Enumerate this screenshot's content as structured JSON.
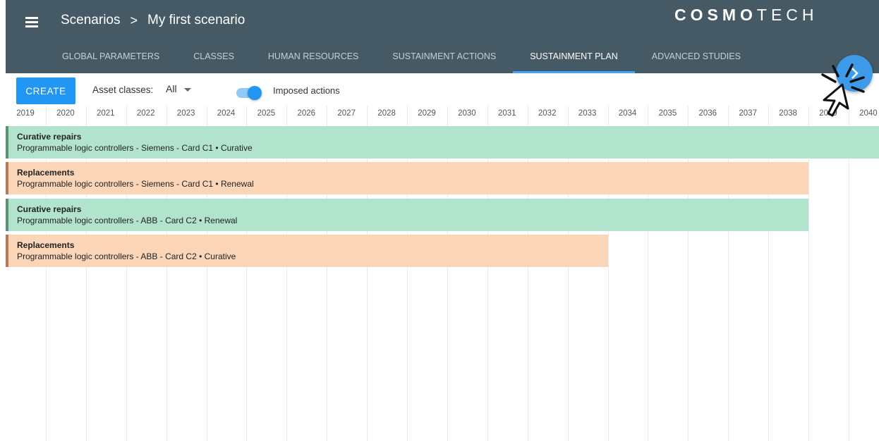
{
  "header": {
    "breadcrumb_root": "Scenarios",
    "breadcrumb_separator": ">",
    "breadcrumb_current": "My first scenario",
    "logo_bold": "COSMO",
    "logo_light": "TECH"
  },
  "tabs": [
    {
      "label": "GLOBAL PARAMETERS"
    },
    {
      "label": "CLASSES"
    },
    {
      "label": "HUMAN RESOURCES"
    },
    {
      "label": "SUSTAINMENT ACTIONS"
    },
    {
      "label": "SUSTAINMENT PLAN"
    },
    {
      "label": "ADVANCED STUDIES"
    }
  ],
  "active_tab": "SUSTAINMENT PLAN",
  "toolbar": {
    "create_label": "CREATE",
    "asset_classes_label": "Asset classes:",
    "asset_classes_value": "All",
    "imposed_actions_label": "Imposed actions",
    "imposed_actions_on": true
  },
  "timeline": {
    "years": [
      "2019",
      "2020",
      "2021",
      "2022",
      "2023",
      "2024",
      "2025",
      "2026",
      "2027",
      "2028",
      "2029",
      "2030",
      "2031",
      "2032",
      "2033",
      "2034",
      "2035",
      "2036",
      "2037",
      "2038",
      "2039",
      "2040"
    ]
  },
  "actions": [
    {
      "title": "Curative repairs",
      "detail": "Programmable logic controllers - Siemens - Card C1 • Curative",
      "kind": "curative",
      "start_year": 2019,
      "end_year": 2040
    },
    {
      "title": "Replacements",
      "detail": "Programmable logic controllers - Siemens - Card C1 • Renewal",
      "kind": "replacement",
      "start_year": 2019,
      "end_year": 2038
    },
    {
      "title": "Curative repairs",
      "detail": "Programmable logic controllers - ABB - Card C2 • Renewal",
      "kind": "curative",
      "start_year": 2019,
      "end_year": 2038
    },
    {
      "title": "Replacements",
      "detail": "Programmable logic controllers - ABB - Card C2 • Curative",
      "kind": "replacement",
      "start_year": 2019,
      "end_year": 2033
    }
  ],
  "colors": {
    "appbar": "#455a64",
    "accent": "#2196f3",
    "curative": "#b2e4cd",
    "replacement": "#fbd5b8"
  }
}
